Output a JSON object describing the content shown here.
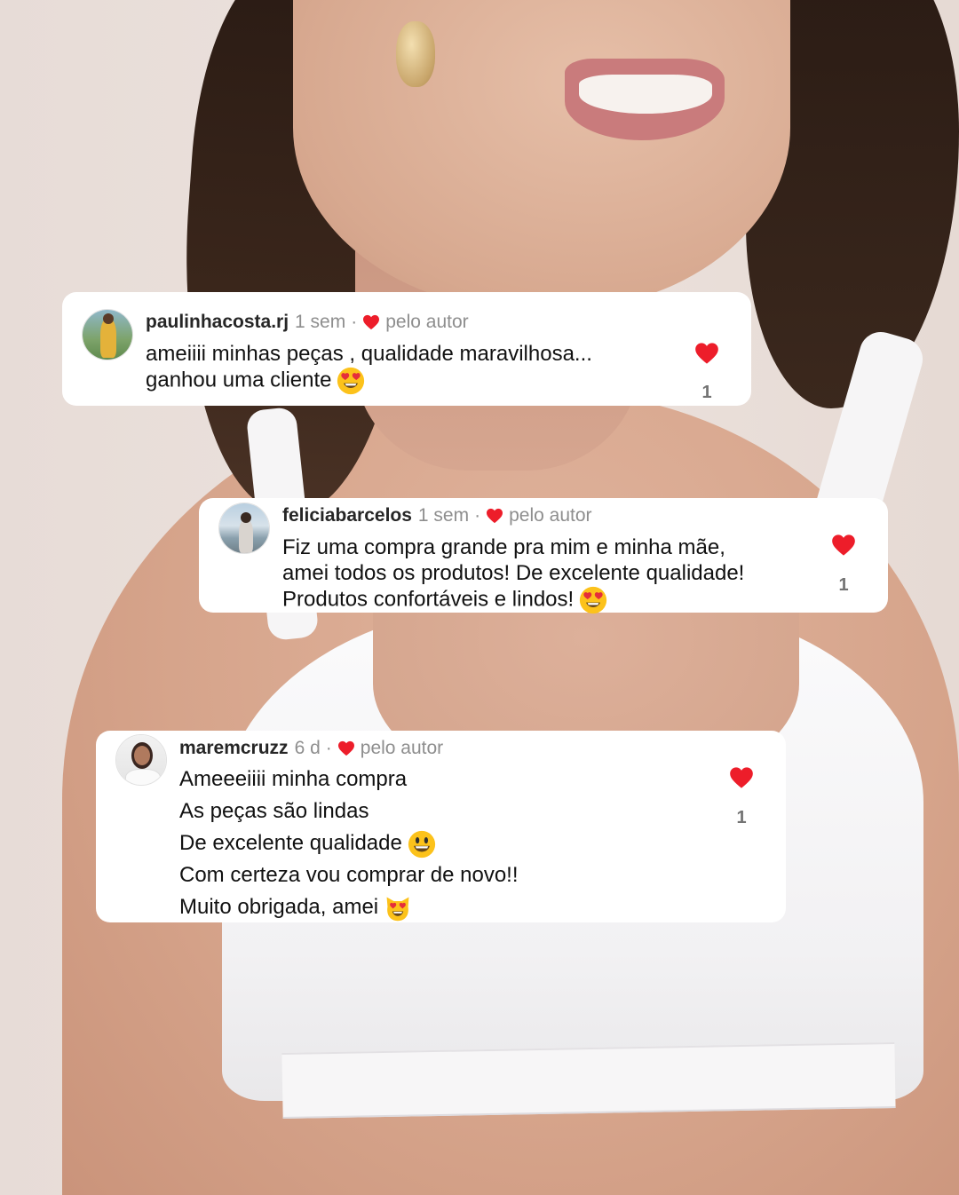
{
  "colors": {
    "heart": "#ed1d2a",
    "card_bg": "#ffffff",
    "username": "#262626",
    "meta_gray": "#8e8e8e",
    "body_text": "#111111"
  },
  "comments": [
    {
      "username": "paulinhacosta.rj",
      "time": "1 sem",
      "separator": "·",
      "liked_by_author": "pelo autor",
      "lines": [
        "ameiiii minhas peças , qualidade maravilhosa...",
        "ganhou uma cliente"
      ],
      "emoji": "heart-eyes-emoji",
      "like_icon": "heart-icon",
      "likes": "1"
    },
    {
      "username": "feliciabarcelos",
      "time": "1 sem",
      "separator": "·",
      "liked_by_author": "pelo autor",
      "lines": [
        "Fiz uma compra grande pra mim e minha mãe,",
        "amei todos os produtos! De excelente qualidade!",
        "Produtos confortáveis e lindos!"
      ],
      "emoji": "heart-eyes-emoji",
      "like_icon": "heart-icon",
      "likes": "1"
    },
    {
      "username": "maremcruzz",
      "time": "6 d",
      "separator": "·",
      "liked_by_author": "pelo autor",
      "lines": [
        "Ameeeiiii minha compra",
        "As peças são lindas",
        "De excelente qualidade",
        "Com certeza vou comprar de novo!!",
        "Muito obrigada, amei"
      ],
      "line_emojis": [
        "smiley-emoji",
        "heart-eyes-cat-emoji"
      ],
      "like_icon": "heart-icon",
      "likes": "1"
    }
  ]
}
